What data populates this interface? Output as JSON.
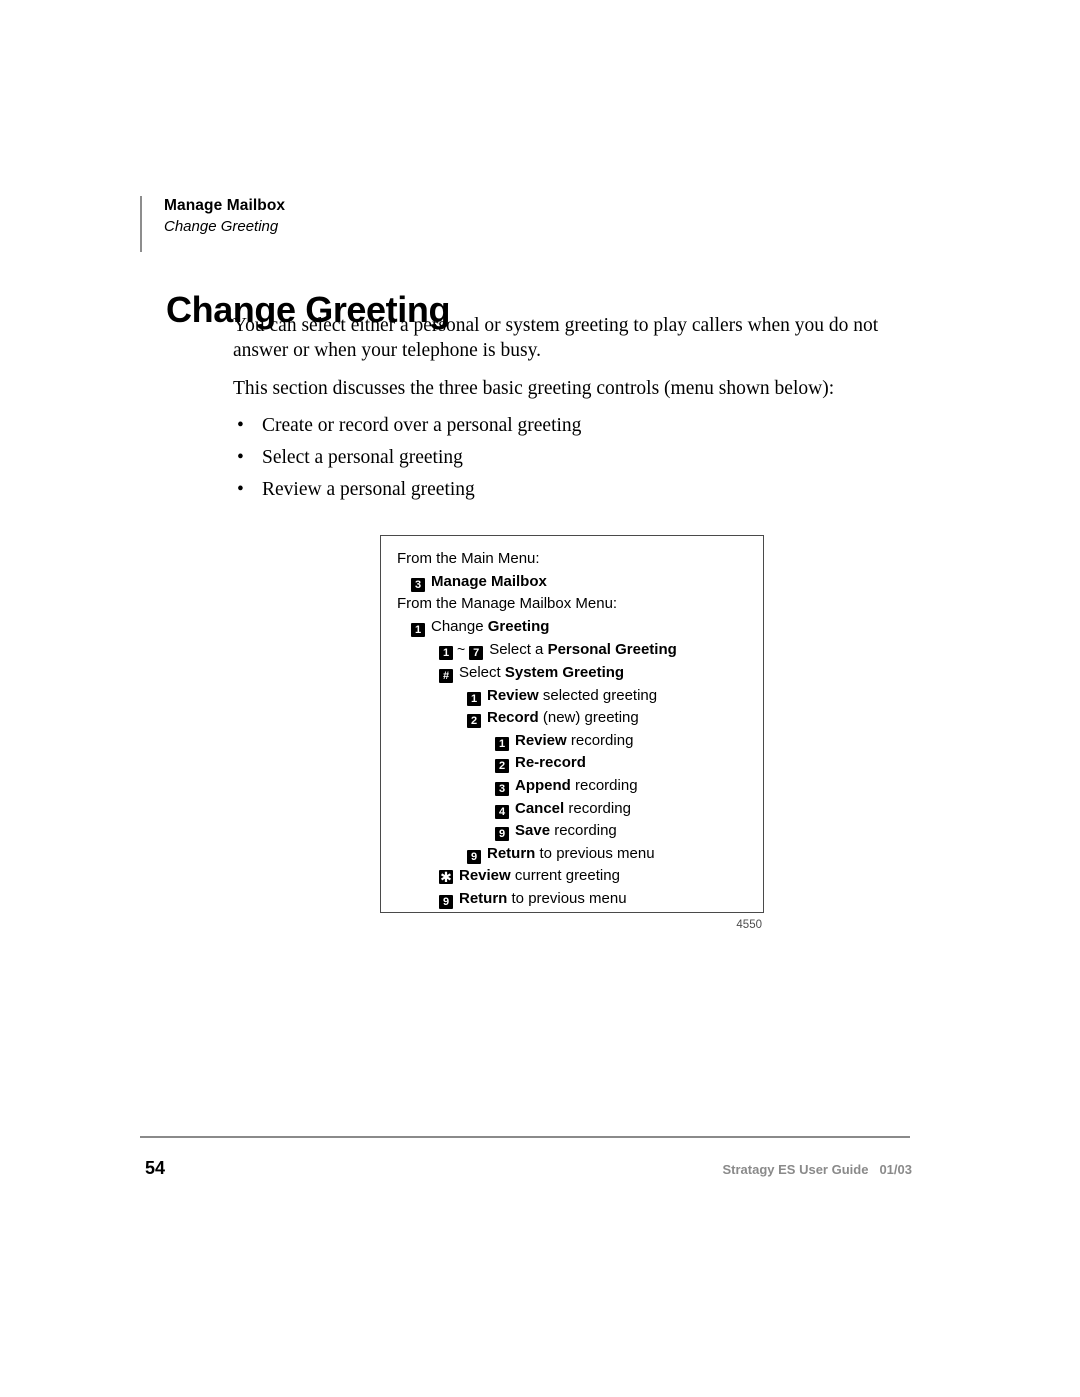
{
  "running_header": {
    "title": "Manage Mailbox",
    "subtitle": "Change Greeting"
  },
  "page_title": "Change Greeting",
  "body": {
    "paragraph_1": "You can select either a personal or system greeting to play callers when you do not answer or when your telephone is busy.",
    "paragraph_2": "This section discusses the three basic greeting controls (menu shown below):",
    "bullet_char": "•",
    "bullets": [
      "Create or record over a personal greeting",
      "Select a personal greeting",
      "Review a personal greeting"
    ]
  },
  "menu_figure": {
    "figure_id": "4550",
    "rows": [
      {
        "type": "text",
        "indent": 0,
        "text": "From the Main Menu:"
      },
      {
        "type": "key",
        "indent": 1,
        "key": "3",
        "bold_text": "Manage Mailbox",
        "plain_text": ""
      },
      {
        "type": "text",
        "indent": 0,
        "text": "From the Manage Mailbox Menu:"
      },
      {
        "type": "key",
        "indent": 1,
        "key": "1",
        "lead_plain": "Change ",
        "bold_text": "Greeting",
        "plain_text": ""
      },
      {
        "type": "range",
        "indent": 2,
        "key_from": "1",
        "separator": "~",
        "key_to": "7",
        "lead_plain": "Select a ",
        "bold_text": "Personal Greeting",
        "plain_text": ""
      },
      {
        "type": "key",
        "indent": 2,
        "key": "#",
        "lead_plain": "Select ",
        "bold_text": "System Greeting",
        "plain_text": ""
      },
      {
        "type": "key",
        "indent": 3,
        "key": "1",
        "bold_text": "Review",
        "plain_text": " selected greeting"
      },
      {
        "type": "key",
        "indent": 3,
        "key": "2",
        "bold_text": "Record",
        "plain_text": " (new) greeting"
      },
      {
        "type": "key",
        "indent": 4,
        "key": "1",
        "bold_text": "Review",
        "plain_text": " recording"
      },
      {
        "type": "key",
        "indent": 4,
        "key": "2",
        "bold_text": "Re-record",
        "plain_text": ""
      },
      {
        "type": "key",
        "indent": 4,
        "key": "3",
        "bold_text": "Append",
        "plain_text": " recording"
      },
      {
        "type": "key",
        "indent": 4,
        "key": "4",
        "bold_text": "Cancel",
        "plain_text": " recording"
      },
      {
        "type": "key",
        "indent": 4,
        "key": "9",
        "bold_text": "Save",
        "plain_text": " recording"
      },
      {
        "type": "key",
        "indent": 3,
        "key": "9",
        "bold_text": "Return",
        "plain_text": " to previous menu"
      },
      {
        "type": "key",
        "indent": 2,
        "key": "✱",
        "key_class": "star",
        "bold_text": "Review",
        "plain_text": " current greeting"
      },
      {
        "type": "key",
        "indent": 2,
        "key": "9",
        "bold_text": "Return",
        "plain_text": " to previous menu"
      }
    ]
  },
  "footer": {
    "page_number": "54",
    "guide_name": "Stratagy ES User Guide",
    "date": "01/03"
  }
}
